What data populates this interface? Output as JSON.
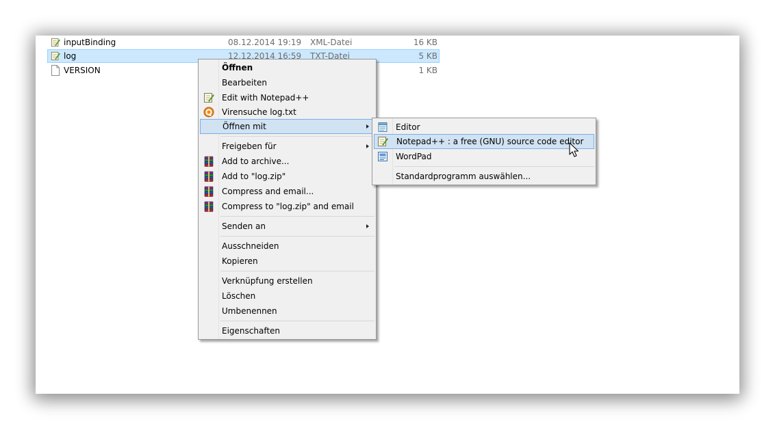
{
  "files": [
    {
      "name": "inputBinding",
      "date": "08.12.2014 19:19",
      "type": "XML-Datei",
      "size": "16 KB",
      "icon": "notepadpp-file-icon"
    },
    {
      "name": "log",
      "date": "12.12.2014 16:59",
      "type": "TXT-Datei",
      "size": "5 KB",
      "icon": "notepadpp-file-icon"
    },
    {
      "name": "VERSION",
      "date": "",
      "type": "",
      "size": "1 KB",
      "icon": "blank-file-icon"
    }
  ],
  "context_menu": {
    "items": [
      {
        "label": "Öffnen"
      },
      {
        "label": "Bearbeiten"
      },
      {
        "label": "Edit with Notepad++",
        "icon": "notepadpp-icon"
      },
      {
        "label": "Virensuche log.txt",
        "icon": "antivirus-icon"
      },
      {
        "label": "Öffnen mit"
      },
      {
        "label": "Freigeben für"
      },
      {
        "label": "Add to archive...",
        "icon": "winrar-icon"
      },
      {
        "label": "Add to \"log.zip\"",
        "icon": "winrar-icon"
      },
      {
        "label": "Compress and email...",
        "icon": "winrar-icon"
      },
      {
        "label": "Compress to \"log.zip\" and email",
        "icon": "winrar-icon"
      },
      {
        "label": "Senden an"
      },
      {
        "label": "Ausschneiden"
      },
      {
        "label": "Kopieren"
      },
      {
        "label": "Verknüpfung erstellen"
      },
      {
        "label": "Löschen"
      },
      {
        "label": "Umbenennen"
      },
      {
        "label": "Eigenschaften"
      }
    ]
  },
  "open_with_menu": {
    "items": [
      {
        "label": "Editor",
        "icon": "notepad-icon"
      },
      {
        "label": "Notepad++ : a free (GNU) source code editor",
        "icon": "notepadpp-icon"
      },
      {
        "label": "WordPad",
        "icon": "wordpad-icon"
      },
      {
        "label": "Standardprogramm auswählen..."
      }
    ]
  },
  "colors": {
    "selection_bg": "#cce8ff",
    "menu_hover_bg": "#d1e2f2",
    "menu_hover_border": "#78aee5",
    "menu_bg": "#f0f0f0"
  }
}
